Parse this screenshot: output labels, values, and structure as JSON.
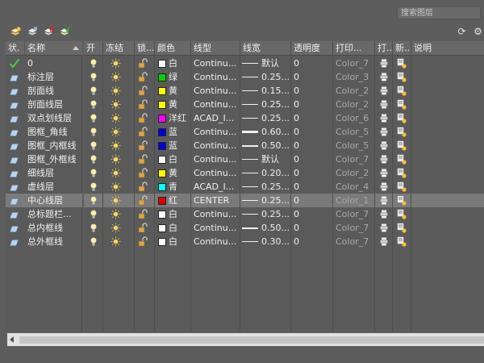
{
  "search": {
    "placeholder": "搜索图层"
  },
  "filter_panel": {
    "headers": {
      "status": "状.",
      "name": "名称"
    }
  },
  "columns": {
    "on": "开",
    "freeze": "冻结",
    "lock": "锁...",
    "color": "颜色",
    "linetype": "线型",
    "lineweight": "线宽",
    "transparency": "透明度",
    "plot_style": "打印...",
    "plot": "打...",
    "new_vp_freeze": "新...",
    "description": "说明"
  },
  "layers": [
    {
      "status": "current",
      "name": "0",
      "color_hex": "#ffffff",
      "color": "白",
      "linetype": "Continu...",
      "lw_thick": 1,
      "lineweight": "默认",
      "transparency": "0",
      "plot_style": "Color_7",
      "selected": false
    },
    {
      "status": "layer",
      "name": "标注层",
      "color_hex": "#00d400",
      "color": "绿",
      "linetype": "Continu...",
      "lw_thick": 1,
      "lineweight": "0.25...",
      "transparency": "0",
      "plot_style": "Color_3",
      "selected": false
    },
    {
      "status": "layer",
      "name": "剖面线",
      "color_hex": "#ffff00",
      "color": "黄",
      "linetype": "Continu...",
      "lw_thick": 1,
      "lineweight": "0.15...",
      "transparency": "0",
      "plot_style": "Color_2",
      "selected": false
    },
    {
      "status": "layer",
      "name": "剖面线层",
      "color_hex": "#ffff00",
      "color": "黄",
      "linetype": "Continu...",
      "lw_thick": 1,
      "lineweight": "0.25...",
      "transparency": "0",
      "plot_style": "Color_2",
      "selected": false
    },
    {
      "status": "layer",
      "name": "双点划线层",
      "color_hex": "#ff00ff",
      "color": "洋红",
      "linetype": "ACAD_I...",
      "lw_thick": 1,
      "lineweight": "0.25...",
      "transparency": "0",
      "plot_style": "Color_6",
      "selected": false
    },
    {
      "status": "layer",
      "name": "图框_角线",
      "color_hex": "#0000dd",
      "color": "蓝",
      "linetype": "Continu...",
      "lw_thick": 3,
      "lineweight": "0.60...",
      "transparency": "0",
      "plot_style": "Color_5",
      "selected": false
    },
    {
      "status": "layer",
      "name": "图框_内框线",
      "color_hex": "#0000dd",
      "color": "蓝",
      "linetype": "Continu...",
      "lw_thick": 2,
      "lineweight": "0.50...",
      "transparency": "0",
      "plot_style": "Color_5",
      "selected": false
    },
    {
      "status": "layer",
      "name": "图框_外框线",
      "color_hex": "#ffffff",
      "color": "白",
      "linetype": "Continu...",
      "lw_thick": 1,
      "lineweight": "默认",
      "transparency": "0",
      "plot_style": "Color_7",
      "selected": false
    },
    {
      "status": "layer",
      "name": "细线层",
      "color_hex": "#ffff00",
      "color": "黄",
      "linetype": "Continu...",
      "lw_thick": 1,
      "lineweight": "0.20...",
      "transparency": "0",
      "plot_style": "Color_2",
      "selected": false
    },
    {
      "status": "layer",
      "name": "虚线层",
      "color_hex": "#00ffff",
      "color": "青",
      "linetype": "ACAD_I...",
      "lw_thick": 1,
      "lineweight": "0.25...",
      "transparency": "0",
      "plot_style": "Color_4",
      "selected": false
    },
    {
      "status": "layer",
      "name": "中心线层",
      "color_hex": "#e00000",
      "color": "红",
      "linetype": "CENTER",
      "lw_thick": 1,
      "lineweight": "0.25...",
      "transparency": "0",
      "plot_style": "Color_1",
      "selected": true
    },
    {
      "status": "layer",
      "name": "总标题栏...",
      "color_hex": "#ffffff",
      "color": "白",
      "linetype": "Continu...",
      "lw_thick": 1,
      "lineweight": "0.25...",
      "transparency": "0",
      "plot_style": "Color_7",
      "selected": false
    },
    {
      "status": "layer",
      "name": "总内框线",
      "color_hex": "#ffffff",
      "color": "白",
      "linetype": "Continu...",
      "lw_thick": 2,
      "lineweight": "0.50...",
      "transparency": "0",
      "plot_style": "Color_7",
      "selected": false
    },
    {
      "status": "layer",
      "name": "总外框线",
      "color_hex": "#ffffff",
      "color": "白",
      "linetype": "Continu...",
      "lw_thick": 1,
      "lineweight": "0.30...",
      "transparency": "0",
      "plot_style": "Color_7",
      "selected": false
    }
  ],
  "icons": {
    "toolbar": [
      "new-layer-icon",
      "new-vp-frozen-layer-icon",
      "delete-layer-icon",
      "set-current-icon"
    ],
    "toolbar_right": [
      "refresh-icon",
      "settings-icon"
    ]
  },
  "theme": {
    "background": "#5d5d5d",
    "selected_row": "#7a7a7a",
    "plot_style_text": "#a9a9a9"
  }
}
